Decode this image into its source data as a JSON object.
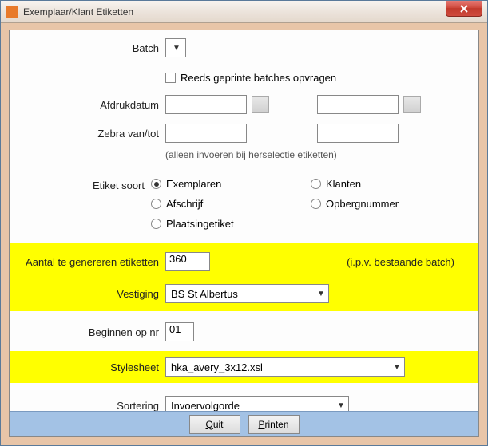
{
  "window": {
    "title": "Exemplaar/Klant Etiketten"
  },
  "labels": {
    "batch": "Batch",
    "reeds": "Reeds geprinte batches opvragen",
    "afdrukdatum": "Afdrukdatum",
    "zebra": "Zebra van/tot",
    "zebra_hint": "(alleen invoeren bij herselectie etiketten)",
    "etiket_soort": "Etiket soort",
    "aantal": "Aantal te genereren etiketten",
    "aantal_value": "360",
    "ipv": "(i.p.v. bestaande batch)",
    "vestiging": "Vestiging",
    "vestiging_value": "BS St Albertus",
    "beginnen": "Beginnen op nr",
    "beginnen_value": "01",
    "stylesheet": "Stylesheet",
    "stylesheet_value": "hka_avery_3x12.xsl",
    "sortering": "Sortering",
    "sortering_value": "Invoervolgorde"
  },
  "radios": {
    "exemplaren": "Exemplaren",
    "klanten": "Klanten",
    "afschrijf": "Afschrijf",
    "opbergnummer": "Opbergnummer",
    "plaatsingetiket": "Plaatsingetiket"
  },
  "buttons": {
    "quit_u": "Q",
    "quit_rest": "uit",
    "printen_u": "P",
    "printen_rest": "rinten"
  }
}
